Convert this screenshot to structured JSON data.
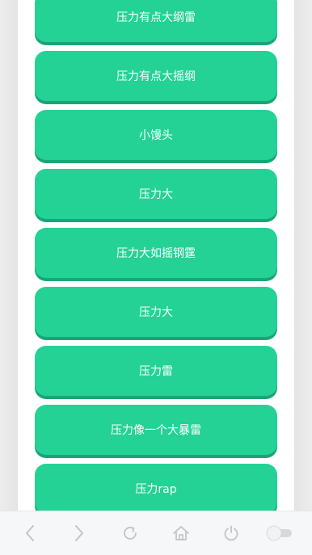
{
  "buttons": [
    {
      "label": "压力有点大纲雷"
    },
    {
      "label": "压力有点大摇纲"
    },
    {
      "label": "小馒头"
    },
    {
      "label": "压力大"
    },
    {
      "label": "压力大如摇钢霆"
    },
    {
      "label": "压力大"
    },
    {
      "label": "压力雷"
    },
    {
      "label": "压力像一个大暴雷"
    },
    {
      "label": "压力rap"
    }
  ],
  "toolbar": {
    "icons": [
      "back-icon",
      "forward-icon",
      "refresh-icon",
      "home-icon",
      "power-icon",
      "toggle-switch"
    ],
    "toggle_on": false
  },
  "colors": {
    "button": "#24d296",
    "button_shadow": "#1aa576",
    "toolbar_icon": "#c4c4c4"
  }
}
